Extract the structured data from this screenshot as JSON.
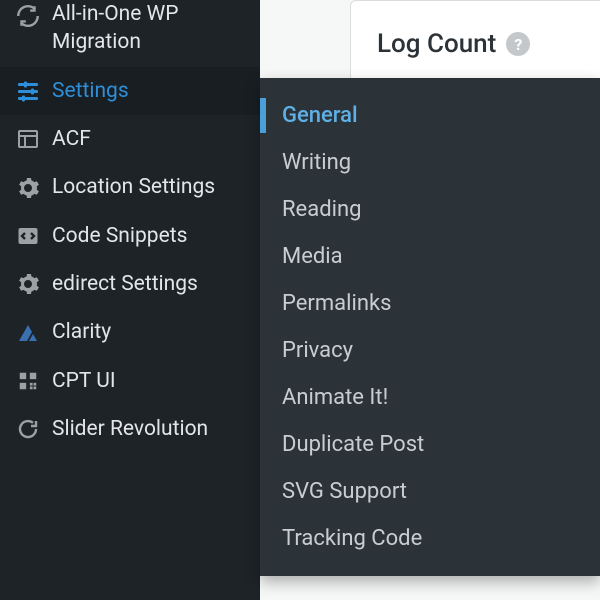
{
  "sidebar": {
    "items": [
      {
        "label": "All-in-One WP Migration",
        "icon": "refresh-icon"
      },
      {
        "label": "Settings",
        "icon": "sliders-icon",
        "active": true
      },
      {
        "label": "ACF",
        "icon": "grid-icon"
      },
      {
        "label": "Location Settings",
        "icon": "gear-icon"
      },
      {
        "label": "Code Snippets",
        "icon": "code-icon"
      },
      {
        "label": "edirect Settings",
        "icon": "gear-icon"
      },
      {
        "label": "Clarity",
        "icon": "clarity-icon"
      },
      {
        "label": "CPT UI",
        "icon": "blocks-icon"
      },
      {
        "label": "Slider Revolution",
        "icon": "cycle-icon"
      }
    ]
  },
  "flyout": {
    "items": [
      {
        "label": "General",
        "current": true
      },
      {
        "label": "Writing"
      },
      {
        "label": "Reading"
      },
      {
        "label": "Media"
      },
      {
        "label": "Permalinks"
      },
      {
        "label": "Privacy"
      },
      {
        "label": "Animate It!"
      },
      {
        "label": "Duplicate Post"
      },
      {
        "label": "SVG Support"
      },
      {
        "label": "Tracking Code"
      }
    ]
  },
  "content": {
    "card_title": "Log Count",
    "help": "?"
  }
}
